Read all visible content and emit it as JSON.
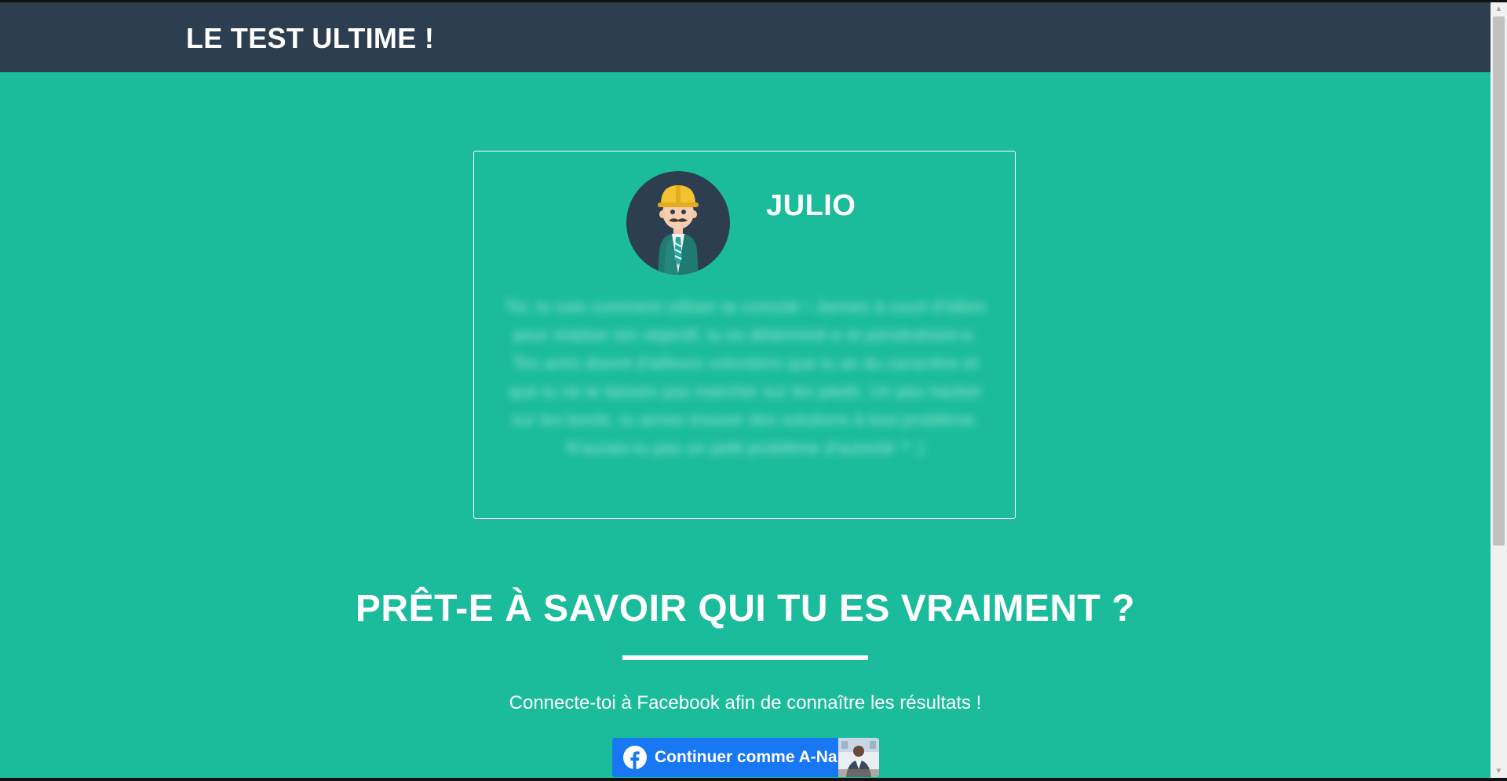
{
  "header": {
    "title": "LE TEST ULTIME !"
  },
  "card": {
    "name": "JULIO",
    "description": "Toi, tu sais comment utiliser ta console ! Jamais à court d'idées pour réaliser ton objectif, tu es déterminé-e et persévérant-e. Tes amis disent d'ailleurs volontiers que tu as du caractère et que tu ne te laisses pas marcher sur les pieds. Un peu hacker sur les bords, tu aimes trouver des solutions à tout problème. N'aurais-tu pas un petit problème d'autorité ? ;)"
  },
  "main": {
    "headline": "PRÊT-E À SAVOIR QUI TU ES VRAIMENT ?",
    "subtext": "Connecte-toi à Facebook afin de connaître les résultats !"
  },
  "facebook": {
    "button_label": "Continuer comme A-Na"
  },
  "colors": {
    "page_bg": "#1abc9c",
    "navbar_bg": "#2c3e50",
    "facebook": "#1877f2"
  },
  "icons": [
    "construction-worker-avatar-icon",
    "facebook-logo-icon",
    "user-photo-icon",
    "scroll-up-arrow-icon",
    "scroll-down-arrow-icon"
  ]
}
